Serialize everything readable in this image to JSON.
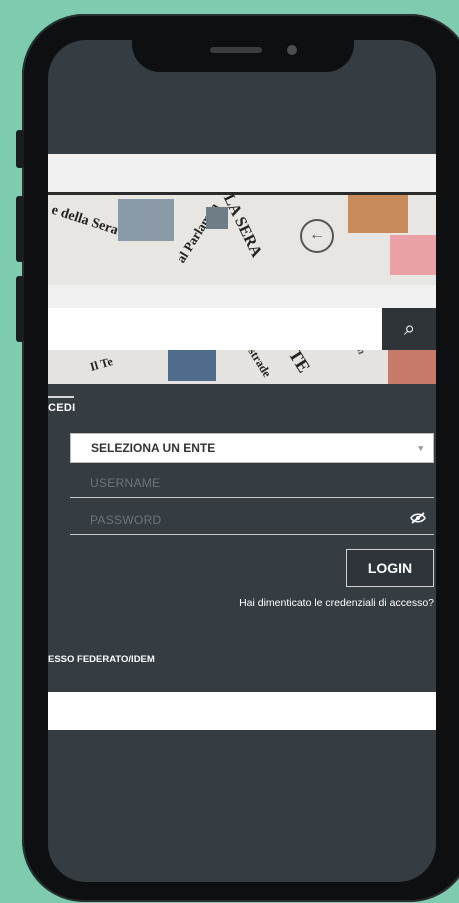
{
  "banner": {
    "newspaper_texts": [
      "e della Sera",
      "al Parlamen",
      "LA SERA",
      "Il Te",
      "Ponti, strade",
      "IL TE",
      "e Milan"
    ],
    "back_icon": "arrow-left-circle-icon"
  },
  "search": {
    "placeholder": "",
    "button_icon": "search-icon"
  },
  "login_form": {
    "tab_label": "CEDI",
    "entity_select": "SELEZIONA UN ENTE",
    "username_placeholder": "USERNAME",
    "password_placeholder": "PASSWORD",
    "password_toggle_icon": "eye-slash-icon",
    "login_label": "LOGIN",
    "forgot_label": "Hai dimenticato le credenziali di accesso?",
    "federated_label": "ESSO FEDERATO/IDEM"
  },
  "colors": {
    "background": "#7ecbb0",
    "screen": "#353c42",
    "phone": "#0d0f10"
  }
}
